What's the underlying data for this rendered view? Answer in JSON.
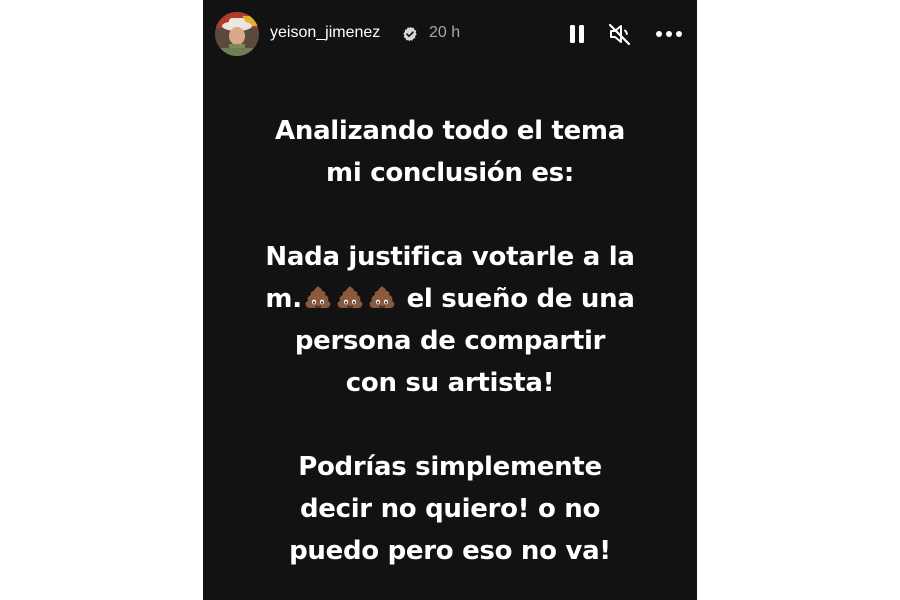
{
  "story": {
    "username": "yeison_jimenez",
    "verified": true,
    "time_ago": "20 h",
    "icons": {
      "pause": "pause-icon",
      "mute": "speaker-muted-icon",
      "more": "more-horizontal-icon",
      "emoji": "pile-of-poo-emoji"
    },
    "colors": {
      "background": "#121212",
      "text": "#ffffff",
      "muted_text": "#a8a8a8"
    }
  },
  "text": {
    "line1": "Analizando todo el tema",
    "line2": "mi conclusión es:",
    "line3": "Nada justifica votarle a la",
    "line4_start": "m.",
    "line4_end": "el sueño de una",
    "line5": "persona de compartir",
    "line6": "con su artista!",
    "line7": "Podrías simplemente",
    "line8": "decir no quiero! o no",
    "line9": "puedo pero eso no va!"
  }
}
